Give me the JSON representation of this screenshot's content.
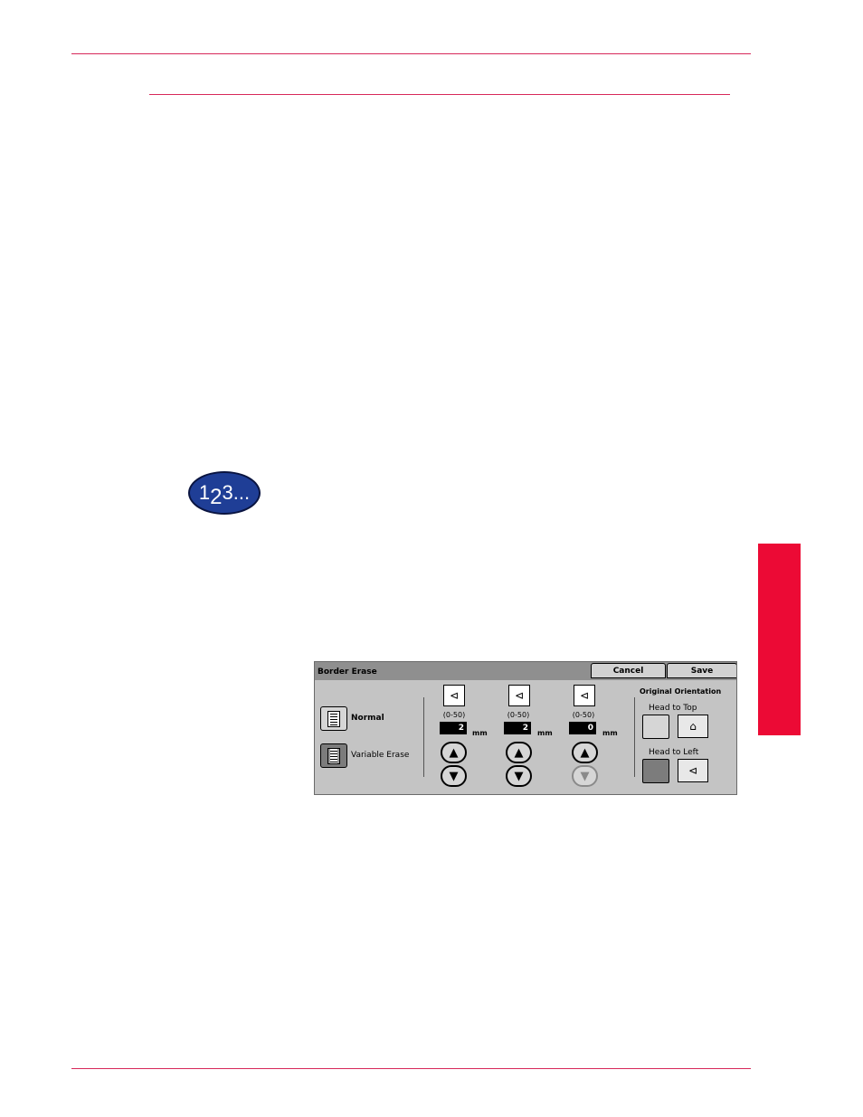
{
  "page": {
    "colors": {
      "rule": "#d7285a",
      "side_tab": "#ec0a35",
      "badge": "#1f3e96"
    }
  },
  "step_badge": {
    "digit1": "1",
    "digit2": "2",
    "digit3": "3",
    "dots": "..."
  },
  "dialog": {
    "title": "Border Erase",
    "cancel_label": "Cancel",
    "save_label": "Save",
    "normal_label": "Normal",
    "variable_label": "Variable Erase",
    "edges": [
      {
        "range": "(0-50)",
        "value": "2",
        "unit": "mm",
        "icon": "edge-top-icon",
        "down_enabled": true
      },
      {
        "range": "(0-50)",
        "value": "2",
        "unit": "mm",
        "icon": "edge-left-icon",
        "down_enabled": true
      },
      {
        "range": "(0-50)",
        "value": "0",
        "unit": "mm",
        "icon": "edge-center-icon",
        "down_enabled": false
      }
    ],
    "orientation_title": "Original Orientation",
    "head_to_top": "Head to Top",
    "head_to_left": "Head to Left"
  }
}
